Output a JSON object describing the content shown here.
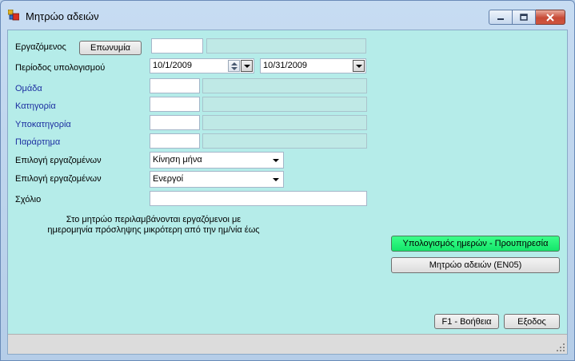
{
  "window": {
    "title": "Μητρώο αδειών"
  },
  "form": {
    "employee_label": "Εργαζόμενος",
    "surname_button": "Επωνυμία",
    "employee_code": "",
    "employee_name": "",
    "period_label": "Περίοδος υπολογισμού",
    "period_from": "10/1/2009",
    "period_to": "10/31/2009",
    "group_label": "Ομάδα",
    "category_label": "Κατηγορία",
    "subcategory_label": "Υποκατηγορία",
    "branch_label": "Παράρτημα",
    "select1_label": "Επιλογή εργαζομένων",
    "select1_value": "Κίνηση μήνα",
    "select2_label": "Επιλογή εργαζομένων",
    "select2_value": "Ενεργοί",
    "comment_label": "Σχόλιο",
    "comment_value": "",
    "note_line1": "Στο μητρώο περιλαμβάνονται εργαζόμενοι με",
    "note_line2": "ημερομηνία πρόσληψης μικρότερη από την ημ/νία έως"
  },
  "actions": {
    "calc_days": "Υπολογισμός ημερών - Προυπηρεσία",
    "leave_register": "Μητρώο αδειών (ΕΝ05)",
    "help": "F1 - Βοήθεια",
    "exit": "Εξοδος"
  },
  "colors": {
    "client_bg": "#b5ece9",
    "accent_green": "#14e56a",
    "label_blue": "#1c2ea0"
  }
}
